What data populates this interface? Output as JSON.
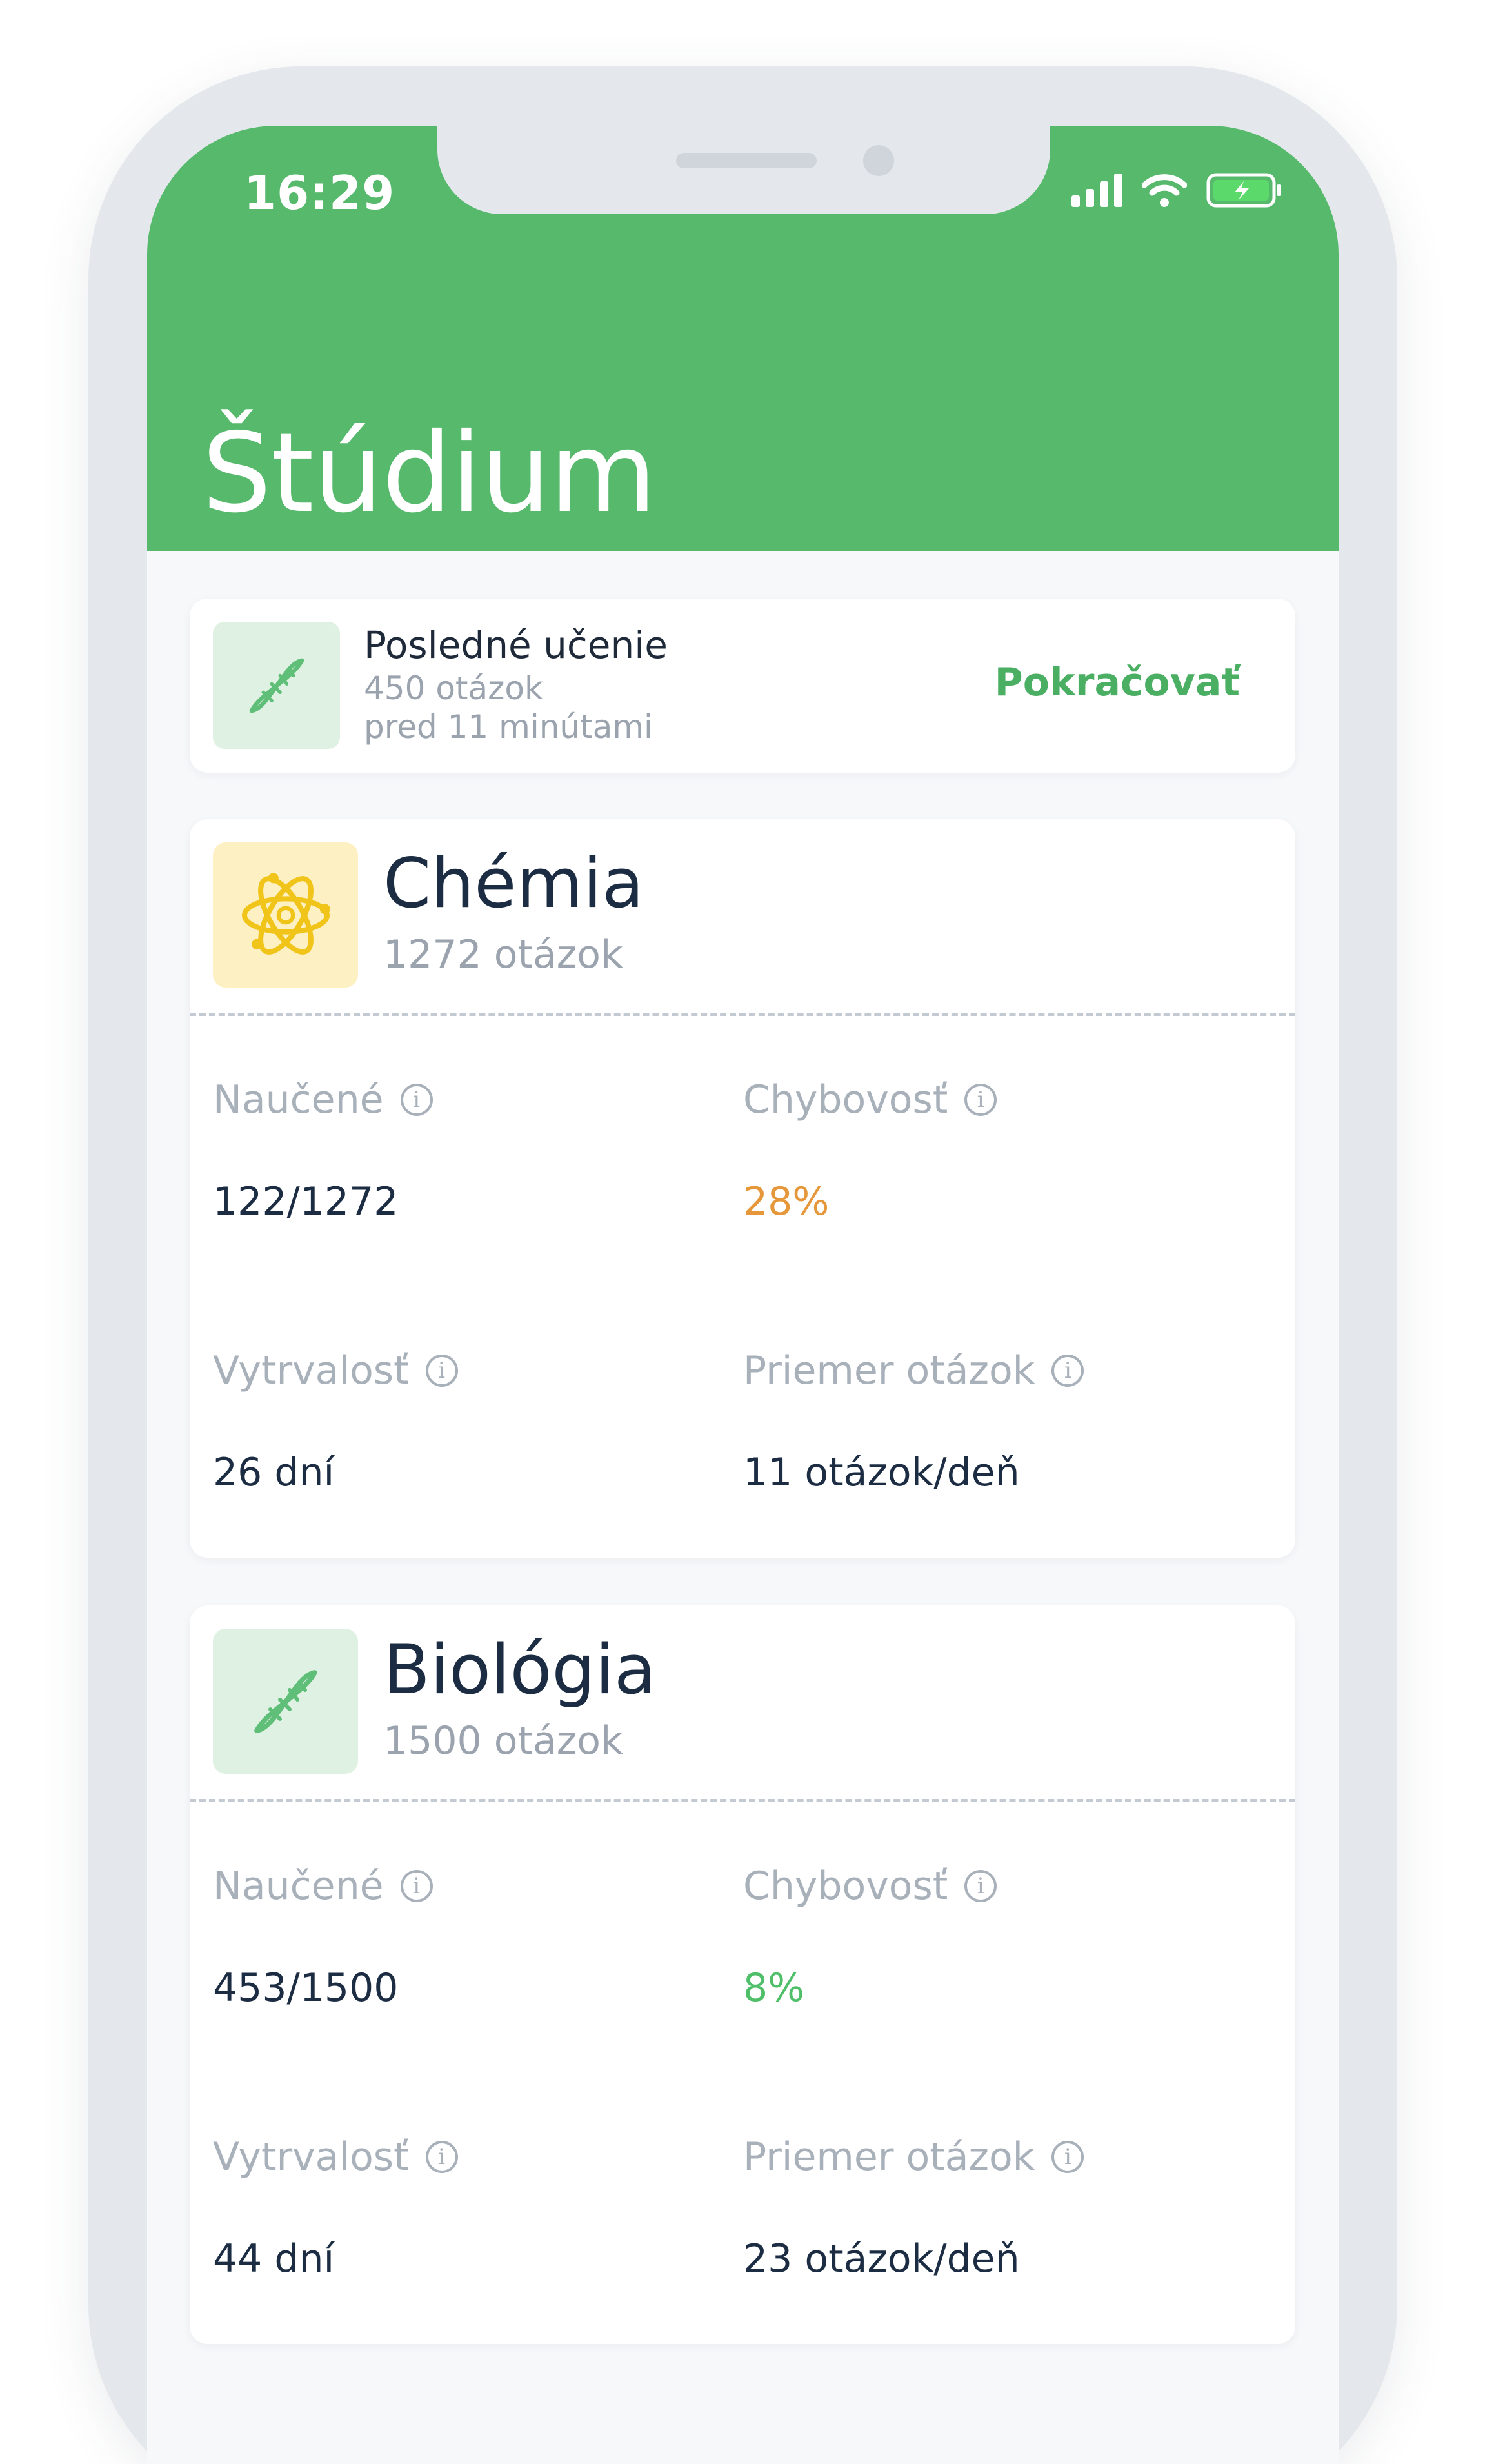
{
  "status_bar": {
    "time": "16:29"
  },
  "header": {
    "title": "Štúdium"
  },
  "recent": {
    "title": "Posledné učenie",
    "questions": "450 otázok",
    "time_ago": "pred 11 minútami",
    "action_label": "Pokračovať",
    "icon": "dna-icon"
  },
  "subjects": [
    {
      "name": "Chémia",
      "count": "1272 otázok",
      "icon": "atom-icon",
      "stats": {
        "learned_label": "Naučené",
        "learned_value": "122/1272",
        "error_label": "Chybovosť",
        "error_value": "28%",
        "error_color": "#e5973a",
        "streak_label": "Vytrvalosť",
        "streak_value": "26 dní",
        "average_label": "Priemer otázok",
        "average_value": "11 otázok/deň"
      }
    },
    {
      "name": "Biológia",
      "count": "1500 otázok",
      "icon": "dna-icon",
      "stats": {
        "learned_label": "Naučené",
        "learned_value": "453/1500",
        "error_label": "Chybovosť",
        "error_value": "8%",
        "error_color": "#4fbf6a",
        "streak_label": "Vytrvalosť",
        "streak_value": "44 dní",
        "average_label": "Priemer otázok",
        "average_value": "23 otázok/deň"
      }
    }
  ],
  "colors": {
    "accent": "#57b96c",
    "text_dark": "#1b2c43",
    "text_muted": "#a8b0ba"
  }
}
